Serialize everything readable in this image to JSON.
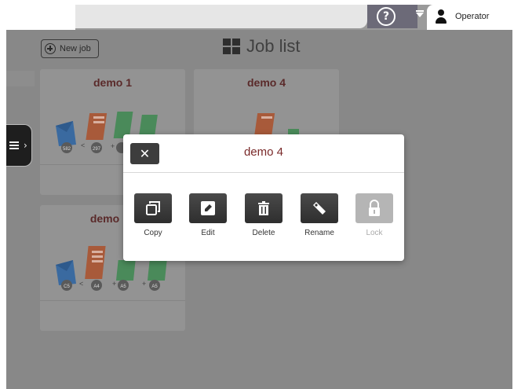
{
  "topbar": {
    "help_icon": "question-circle-icon",
    "dropdown_icon": "caret-down-icon",
    "user_icon": "user-icon",
    "user_label": "Operator"
  },
  "toolbar": {
    "new_job_label": "New job",
    "title": "Job list"
  },
  "jobs": [
    {
      "name": "demo 1",
      "icons": [
        "envelope-icon",
        "document-icon",
        "insert-icon",
        "insert-icon"
      ],
      "badges": [
        "582",
        "297",
        "",
        ""
      ]
    },
    {
      "name": "demo 4",
      "icons": [
        "document-icon",
        "insert-icon"
      ],
      "badges": [
        "",
        ""
      ]
    },
    {
      "name": "demo",
      "icons": [
        "envelope-icon",
        "document-icon",
        "insert-icon",
        "insert-icon"
      ],
      "badges": [
        "C5",
        "A4",
        "A5",
        "A5"
      ]
    }
  ],
  "modal": {
    "title": "demo 4",
    "close_icon": "close-icon",
    "actions": [
      {
        "label": "Copy",
        "icon": "copy-icon",
        "enabled": true
      },
      {
        "label": "Edit",
        "icon": "edit-icon",
        "enabled": true
      },
      {
        "label": "Delete",
        "icon": "trash-icon",
        "enabled": true
      },
      {
        "label": "Rename",
        "icon": "tag-icon",
        "enabled": true
      },
      {
        "label": "Lock",
        "icon": "lock-icon",
        "enabled": false
      }
    ]
  },
  "colors": {
    "overlay": "#888888",
    "title_text": "#7a2a2a",
    "button_dark": "#3d3d3d",
    "envelope": "#3a78c0",
    "document": "#b04a2a",
    "insert": "#2f8f4a"
  }
}
